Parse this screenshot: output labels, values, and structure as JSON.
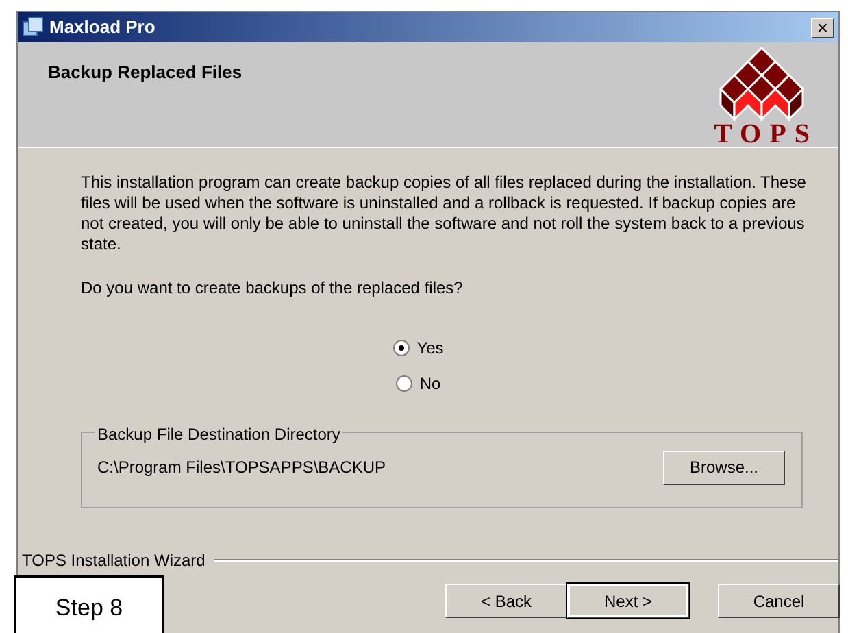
{
  "window": {
    "title": "Maxload Pro",
    "close": "×"
  },
  "header": {
    "title": "Backup Replaced Files",
    "logo_text": "TOPS"
  },
  "description": "This installation program can create backup copies of all files replaced during the installation. These files will be used when the software is uninstalled and a rollback is requested.  If backup copies are not created, you will only be able to uninstall the software and not roll the system back to a previous state.",
  "question": "Do you want to create backups of the replaced files?",
  "options": [
    {
      "label": "Yes",
      "selected": true
    },
    {
      "label": "No",
      "selected": false
    }
  ],
  "destination": {
    "legend": "Backup File Destination Directory",
    "path": "C:\\Program Files\\TOPSAPPS\\BACKUP",
    "button": "Browse..."
  },
  "footer": {
    "label": "TOPS Installation Wizard",
    "buttons": [
      {
        "label": "< Back",
        "default": false
      },
      {
        "label": "Next >",
        "default": true
      },
      {
        "label": "Cancel",
        "default": false
      }
    ]
  },
  "step_label": "Step 8"
}
